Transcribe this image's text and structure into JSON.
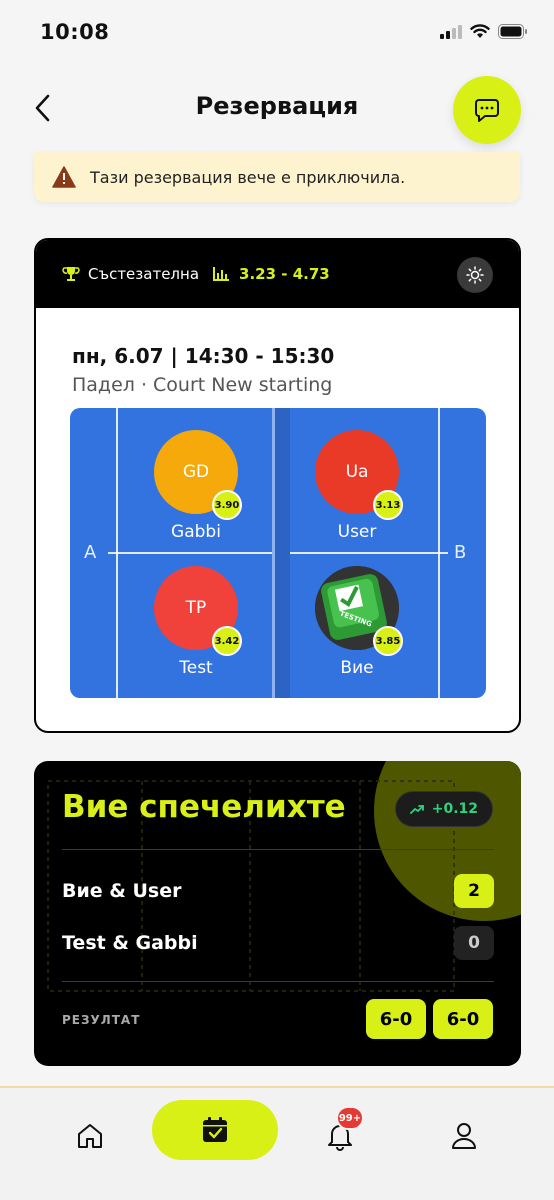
{
  "status_bar": {
    "time": "10:08"
  },
  "header": {
    "title": "Резервация"
  },
  "alert": {
    "text": "Тази резервация вече е приключила."
  },
  "booking": {
    "type_label": "Състезателна",
    "level_range": "3.23 - 4.73",
    "date_time": "пн, 6.07 | 14:30 - 15:30",
    "place": "Падел · Court New starting",
    "court": {
      "side_a": "A",
      "side_b": "B",
      "players": [
        {
          "initials": "GD",
          "name": "Gabbi",
          "rating": "3.90",
          "color": "#f5a90a"
        },
        {
          "initials": "Ua",
          "name": "User",
          "rating": "3.13",
          "color": "#e83a26"
        },
        {
          "initials": "TP",
          "name": "Test",
          "rating": "3.42",
          "color": "#f0413a"
        },
        {
          "initials": "",
          "name": "Вие",
          "rating": "3.85",
          "avatar_text": "TESTING",
          "color": "#2e9a36"
        }
      ]
    }
  },
  "result": {
    "title": "Вие спечелихте",
    "rating_change": "+0.12",
    "teams": [
      {
        "name": "Вие & User",
        "score": "2"
      },
      {
        "name": "Test & Gabbi",
        "score": "0"
      }
    ],
    "score_label": "РЕЗУЛТАТ",
    "sets": [
      "6-0",
      "6-0"
    ]
  },
  "nav": {
    "notifications_badge": "99+"
  },
  "colors": {
    "accent": "#d8f015",
    "court": "#3273e0",
    "dark": "#000000",
    "alert_bg": "#fdf3cf"
  }
}
